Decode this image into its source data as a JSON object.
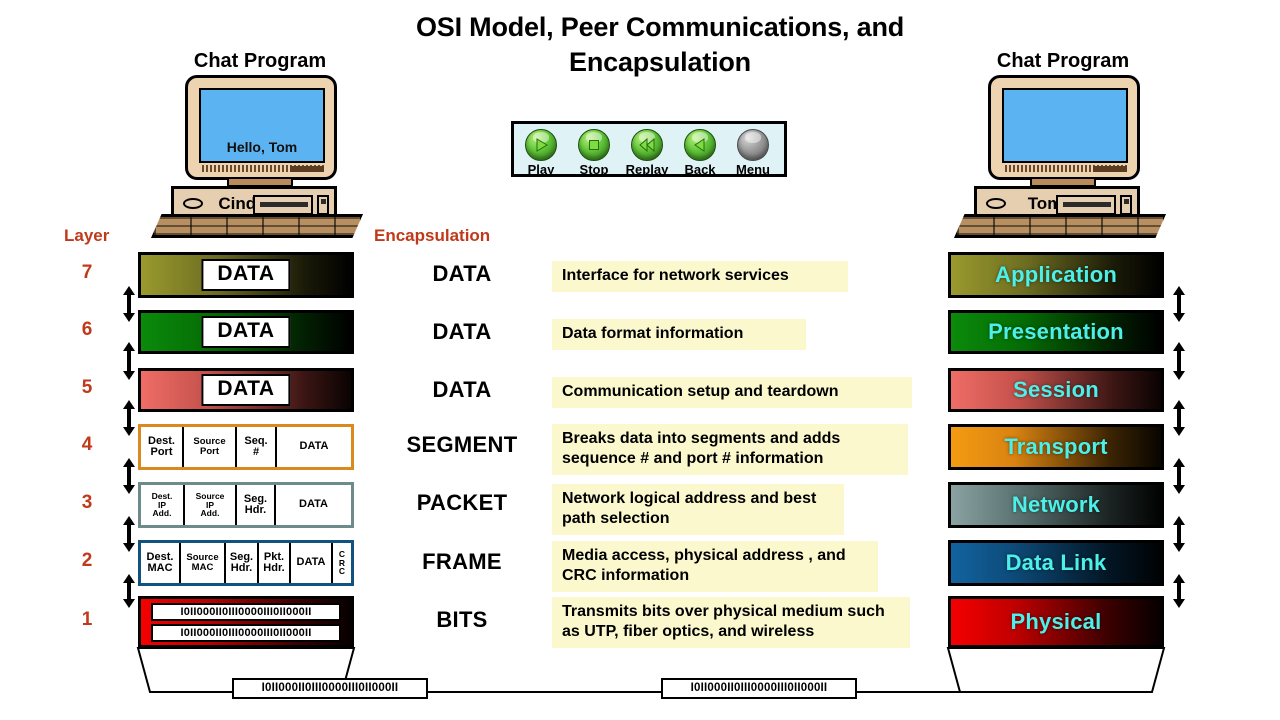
{
  "title": "OSI Model, Peer Communications, and Encapsulation",
  "columns": {
    "layer_header": "Layer",
    "encapsulation_header": "Encapsulation"
  },
  "computers": {
    "left": {
      "program_label": "Chat Program",
      "screen_text": "Hello, Tom",
      "case_name": "Cindy"
    },
    "right": {
      "program_label": "Chat Program",
      "screen_text": "",
      "case_name": "Tom"
    }
  },
  "player": {
    "buttons": [
      {
        "label": "Play",
        "icon": "play-icon",
        "style": "green"
      },
      {
        "label": "Stop",
        "icon": "stop-icon",
        "style": "green"
      },
      {
        "label": "Replay",
        "icon": "rewind-icon",
        "style": "green"
      },
      {
        "label": "Back",
        "icon": "back-icon",
        "style": "green"
      },
      {
        "label": "Menu",
        "icon": "menu-icon",
        "style": "gray"
      }
    ]
  },
  "layers": [
    {
      "number": "7",
      "name": "Application",
      "encapsulation": "DATA",
      "description": "Interface for network services",
      "pdu_kind": "data",
      "data_label": "DATA",
      "fields": [],
      "accent": "#8a8a2a",
      "gradient": "linear-gradient(90deg,#9a9a2e 0%,#6e6e22 35%,#1a1a08 78%,#000000 100%)",
      "desc_width": 296
    },
    {
      "number": "6",
      "name": "Presentation",
      "encapsulation": "DATA",
      "description": "Data format information",
      "pdu_kind": "data",
      "data_label": "DATA",
      "fields": [],
      "accent": "#0b7a0b",
      "gradient": "linear-gradient(90deg,#0b8a0b 0%,#046b04 35%,#021f02 78%,#000000 100%)",
      "desc_width": 254
    },
    {
      "number": "5",
      "name": "Session",
      "encapsulation": "DATA",
      "description": "Communication setup and teardown",
      "pdu_kind": "data",
      "data_label": "DATA",
      "fields": [],
      "accent": "#e0635e",
      "gradient": "linear-gradient(90deg,#ef6d66 0%,#c4514c 32%,#3a1513 78%,#0a0302 100%)",
      "desc_width": 360
    },
    {
      "number": "4",
      "name": "Transport",
      "encapsulation": "SEGMENT",
      "description": "Breaks data into segments and adds sequence # and port # information",
      "pdu_kind": "fields",
      "data_label": "DATA",
      "fields": [
        {
          "lines": [
            "Dest.",
            "Port"
          ],
          "width": 43
        },
        {
          "lines": [
            "Source",
            "Port"
          ],
          "width": 53
        },
        {
          "lines": [
            "Seq.",
            "#"
          ],
          "width": 40
        },
        {
          "lines": [
            "DATA"
          ],
          "width": 74
        }
      ],
      "accent": "#d9891d",
      "gradient": "linear-gradient(90deg,#f59b12 0%,#d98311 30%,#3b2403 76%,#080500 100%)",
      "desc_width": 356
    },
    {
      "number": "3",
      "name": "Network",
      "encapsulation": "PACKET",
      "description": "Network logical address and best path selection",
      "pdu_kind": "fields",
      "data_label": "DATA",
      "fields": [
        {
          "lines": [
            "Dest.",
            "IP",
            "Add."
          ],
          "width": 44
        },
        {
          "lines": [
            "Source",
            "IP",
            "Add."
          ],
          "width": 52
        },
        {
          "lines": [
            "Seg.",
            "Hdr."
          ],
          "width": 39
        },
        {
          "lines": [
            "DATA"
          ],
          "width": 75
        }
      ],
      "accent": "#6e8b8b",
      "gradient": "linear-gradient(90deg,#8aa3a2 0%,#5c7574 30%,#1b2322 76%,#010202 100%)",
      "desc_width": 292
    },
    {
      "number": "2",
      "name": "Data Link",
      "encapsulation": "FRAME",
      "description": "Media access, physical address , and CRC information",
      "pdu_kind": "fields",
      "data_label": "DATA",
      "fields": [
        {
          "lines": [
            "Dest.",
            "MAC"
          ],
          "width": 40
        },
        {
          "lines": [
            "Source",
            "MAC"
          ],
          "width": 45
        },
        {
          "lines": [
            "Seg.",
            "Hdr."
          ],
          "width": 33
        },
        {
          "lines": [
            "Pkt.",
            "Hdr."
          ],
          "width": 32
        },
        {
          "lines": [
            "DATA"
          ],
          "width": 42
        },
        {
          "lines": [
            "C",
            "R",
            "C"
          ],
          "width": 18
        }
      ],
      "accent": "#11537e",
      "gradient": "linear-gradient(90deg,#1263a0 0%,#0d4a78 30%,#031523 76%,#000203 100%)",
      "desc_width": 326
    },
    {
      "number": "1",
      "name": "Physical",
      "encapsulation": "BITS",
      "description": "Transmits bits over physical medium such as UTP, fiber optics, and wireless",
      "pdu_kind": "bits",
      "data_label": "",
      "fields": [],
      "accent": "#e00000",
      "gradient": "linear-gradient(90deg,#f50000 0%,#c00000 30%,#380000 76%,#060000 100%)",
      "desc_width": 358
    }
  ],
  "bits": {
    "pattern": "I0II000II0III0000III0II000II"
  },
  "colors": {
    "header_red": "#c0391b",
    "layer_name_text": "#4df0e8",
    "description_bg": "#fbf8ce",
    "screen_blue": "#5cb3f2",
    "computer_beige": "#edd3b0"
  }
}
